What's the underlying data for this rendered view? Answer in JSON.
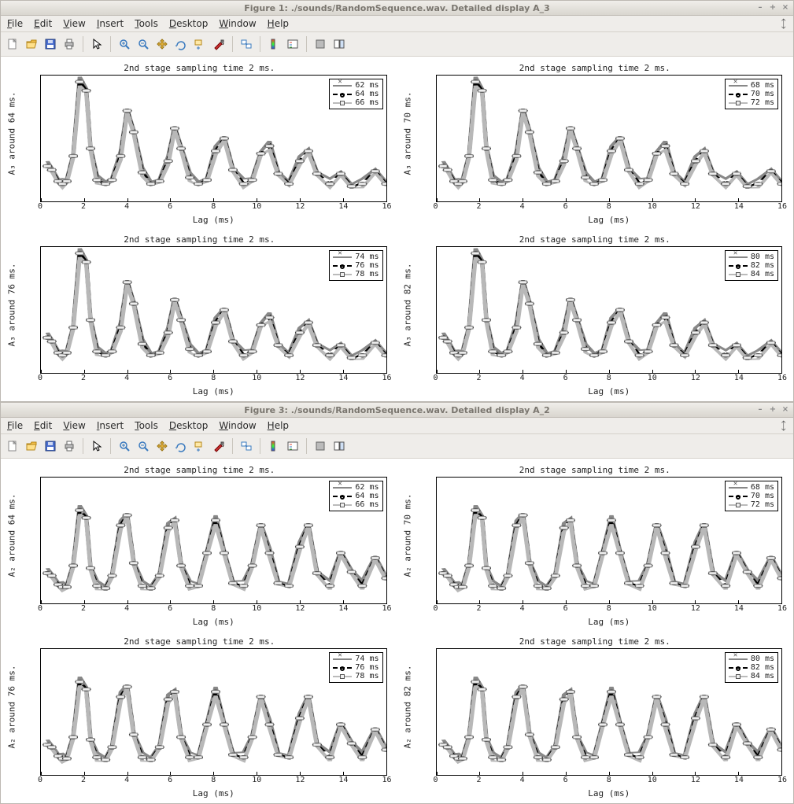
{
  "windows": [
    {
      "title": "Figure 1: ./sounds/RandomSequence.wav. Detailed display A_3",
      "figure_key": "fig1"
    },
    {
      "title": "Figure 3: ./sounds/RandomSequence.wav. Detailed display A_2",
      "figure_key": "fig3"
    }
  ],
  "window_buttons": {
    "minimize": "–",
    "maximize": "+",
    "close": "×"
  },
  "menus": [
    {
      "label": "File",
      "ukey": "F"
    },
    {
      "label": "Edit",
      "ukey": "E"
    },
    {
      "label": "View",
      "ukey": "V"
    },
    {
      "label": "Insert",
      "ukey": "I"
    },
    {
      "label": "Tools",
      "ukey": "T"
    },
    {
      "label": "Desktop",
      "ukey": "D"
    },
    {
      "label": "Window",
      "ukey": "W"
    },
    {
      "label": "Help",
      "ukey": "H"
    }
  ],
  "toolbar_icons": [
    "new-figure-icon",
    "open-file-icon",
    "save-icon",
    "print-icon",
    "sep",
    "pointer-icon",
    "sep",
    "zoom-in-icon",
    "zoom-out-icon",
    "pan-icon",
    "rotate3d-icon",
    "data-cursor-icon",
    "brush-icon",
    "sep",
    "link-plots-icon",
    "sep",
    "insert-colorbar-icon",
    "insert-legend-icon",
    "sep",
    "hide-tools-icon",
    "dock-icon"
  ],
  "chart_data": {
    "fig1": {
      "common": {
        "title_template": "2nd stage sampling time 2 ms.",
        "xlabel": "Lag (ms)",
        "xlim": [
          0,
          16
        ],
        "xticks": [
          0,
          2,
          4,
          6,
          8,
          10,
          12,
          14,
          16
        ],
        "ylim": [
          0,
          1
        ],
        "a_symbol": "A₃",
        "series_profile": {
          "type": "line",
          "x": [
            0.3,
            0.5,
            0.8,
            1.0,
            1.2,
            1.5,
            1.8,
            2.1,
            2.3,
            2.6,
            3.0,
            3.3,
            3.7,
            4.0,
            4.3,
            4.7,
            5.1,
            5.5,
            5.9,
            6.2,
            6.5,
            6.9,
            7.3,
            7.7,
            8.1,
            8.5,
            8.9,
            9.4,
            9.8,
            10.2,
            10.6,
            11.0,
            11.5,
            12.0,
            12.4,
            12.8,
            13.4,
            13.9,
            14.4,
            14.9,
            15.5,
            16.0
          ],
          "values": [
            0.28,
            0.25,
            0.16,
            0.14,
            0.16,
            0.36,
            0.95,
            0.88,
            0.42,
            0.17,
            0.14,
            0.17,
            0.36,
            0.72,
            0.55,
            0.23,
            0.14,
            0.16,
            0.32,
            0.58,
            0.42,
            0.19,
            0.14,
            0.17,
            0.4,
            0.5,
            0.25,
            0.14,
            0.17,
            0.38,
            0.44,
            0.22,
            0.14,
            0.32,
            0.4,
            0.22,
            0.14,
            0.22,
            0.12,
            0.14,
            0.24,
            0.14
          ]
        }
      },
      "subplots": [
        {
          "ylabel": "A₃ around 64 ms.",
          "legend": [
            "62 ms",
            "64 ms",
            "66 ms"
          ]
        },
        {
          "ylabel": "A₃ around 70 ms.",
          "legend": [
            "68 ms",
            "70 ms",
            "72 ms"
          ]
        },
        {
          "ylabel": "A₃ around 76 ms.",
          "legend": [
            "74 ms",
            "76 ms",
            "78 ms"
          ]
        },
        {
          "ylabel": "A₃ around 82 ms.",
          "legend": [
            "80 ms",
            "82 ms",
            "84 ms"
          ]
        }
      ]
    },
    "fig3": {
      "common": {
        "title_template": "2nd stage sampling time 2 ms.",
        "xlabel": "Lag (ms)",
        "xlim": [
          0,
          16
        ],
        "xticks": [
          0,
          2,
          4,
          6,
          8,
          10,
          12,
          14,
          16
        ],
        "ylim": [
          0,
          1
        ],
        "a_symbol": "A₂",
        "series_profile": {
          "type": "line",
          "x": [
            0.3,
            0.5,
            0.8,
            1.0,
            1.2,
            1.5,
            1.8,
            2.1,
            2.3,
            2.6,
            3.0,
            3.3,
            3.7,
            4.0,
            4.3,
            4.7,
            5.1,
            5.5,
            5.9,
            6.2,
            6.5,
            6.9,
            7.3,
            7.7,
            8.1,
            8.5,
            8.9,
            9.4,
            9.8,
            10.2,
            10.6,
            11.0,
            11.5,
            12.0,
            12.4,
            12.8,
            13.4,
            13.9,
            14.4,
            14.9,
            15.5,
            16.0
          ],
          "values": [
            0.24,
            0.22,
            0.15,
            0.13,
            0.13,
            0.3,
            0.74,
            0.68,
            0.28,
            0.14,
            0.12,
            0.22,
            0.62,
            0.7,
            0.32,
            0.14,
            0.12,
            0.22,
            0.6,
            0.66,
            0.3,
            0.14,
            0.14,
            0.4,
            0.66,
            0.4,
            0.16,
            0.14,
            0.3,
            0.62,
            0.4,
            0.16,
            0.14,
            0.45,
            0.62,
            0.24,
            0.14,
            0.4,
            0.25,
            0.14,
            0.36,
            0.2
          ]
        }
      },
      "subplots": [
        {
          "ylabel": "A₂ around 64 ms.",
          "legend": [
            "62 ms",
            "64 ms",
            "66 ms"
          ]
        },
        {
          "ylabel": "A₂ around 70 ms.",
          "legend": [
            "68 ms",
            "70 ms",
            "72 ms"
          ]
        },
        {
          "ylabel": "A₂ around 76 ms.",
          "legend": [
            "74 ms",
            "76 ms",
            "78 ms"
          ]
        },
        {
          "ylabel": "A₂ around 82 ms.",
          "legend": [
            "80 ms",
            "82 ms",
            "84 ms"
          ]
        }
      ]
    }
  }
}
